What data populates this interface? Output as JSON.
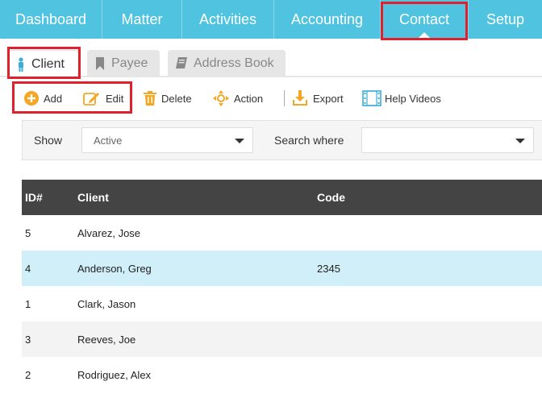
{
  "nav": {
    "items": [
      {
        "label": "Dashboard"
      },
      {
        "label": "Matter"
      },
      {
        "label": "Activities"
      },
      {
        "label": "Accounting"
      },
      {
        "label": "Contact"
      },
      {
        "label": "Setup"
      }
    ],
    "active": "Contact"
  },
  "subtabs": {
    "items": [
      {
        "label": "Client",
        "icon": "person-icon"
      },
      {
        "label": "Payee",
        "icon": "bookmark-icon"
      },
      {
        "label": "Address Book",
        "icon": "book-icon"
      }
    ],
    "active": "Client"
  },
  "toolbar": {
    "add": "Add",
    "edit": "Edit",
    "delete": "Delete",
    "action": "Action",
    "export": "Export",
    "help": "Help Videos"
  },
  "filter": {
    "show_label": "Show",
    "show_value": "Active",
    "search_label": "Search where",
    "search_value": ""
  },
  "table": {
    "headers": {
      "id": "ID#",
      "client": "Client",
      "code": "Code"
    },
    "rows": [
      {
        "id": "5",
        "client": "Alvarez, Jose",
        "code": ""
      },
      {
        "id": "4",
        "client": "Anderson, Greg",
        "code": "2345"
      },
      {
        "id": "1",
        "client": "Clark, Jason",
        "code": ""
      },
      {
        "id": "3",
        "client": "Reeves, Joe",
        "code": ""
      },
      {
        "id": "2",
        "client": "Rodriguez, Alex",
        "code": ""
      }
    ]
  },
  "colors": {
    "nav_bg": "#4fc3df",
    "accent_orange": "#f5a623",
    "highlight_red": "#e0202a",
    "header_dark": "#444444",
    "selected_row": "#d0eff8"
  }
}
